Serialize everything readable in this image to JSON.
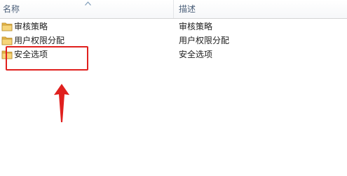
{
  "header": {
    "name_label": "名称",
    "desc_label": "描述"
  },
  "rows": [
    {
      "name": "审核策略",
      "description": "审核策略",
      "icon": "folder-icon"
    },
    {
      "name": "用户权限分配",
      "description": "用户权限分配",
      "icon": "folder-icon"
    },
    {
      "name": "安全选项",
      "description": "安全选项",
      "icon": "folder-icon"
    }
  ],
  "colors": {
    "annotation": "#e0201e",
    "folder": "#f0c552"
  }
}
